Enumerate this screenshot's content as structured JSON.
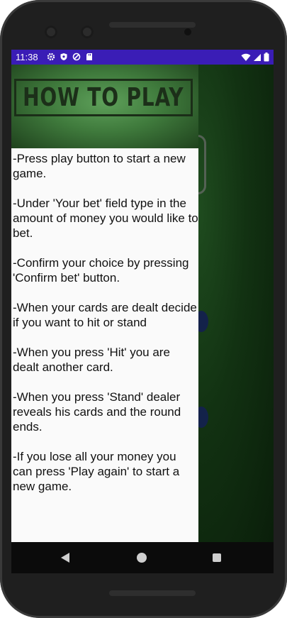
{
  "status_bar": {
    "time": "11:38",
    "icons": [
      "gear-icon",
      "shield-icon",
      "no-sync-icon",
      "sd-card-icon"
    ],
    "right_icons": [
      "wifi-icon",
      "signal-icon",
      "battery-icon"
    ]
  },
  "panel": {
    "title": "HOW TO PLAY",
    "instructions": [
      "-Press play button to start a new game.",
      "-Under 'Your bet' field type in the amount of money you would like to bet.",
      "-Confirm your choice by pressing 'Confirm bet' button.",
      "-When your cards are dealt decide if you want to hit or stand",
      "-When you press 'Hit' you are dealt another card.",
      "-When you press 'Stand' dealer reveals his cards and the round ends.",
      "-If you lose all your money you can press 'Play again' to start a new game."
    ]
  },
  "nav_bar": {
    "buttons": [
      "back-icon",
      "home-icon",
      "recents-icon"
    ]
  },
  "colors": {
    "status_bar": "#3a1db6",
    "title_text": "#1c2f19",
    "felt_green": "#3f7a3c",
    "table_green": "#123212"
  }
}
